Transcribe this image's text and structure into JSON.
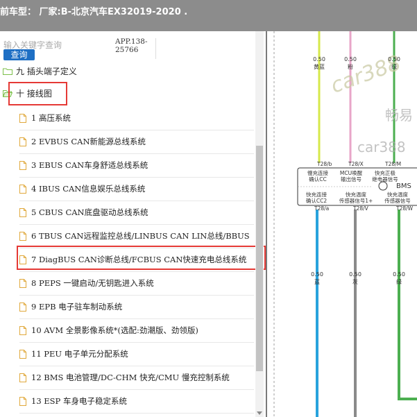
{
  "header": {
    "title": "前车型：  厂家:B-北京汽车EX32019-2020   ."
  },
  "search": {
    "placeholder": "输入关键字查询",
    "button": "查询"
  },
  "app_code": "APP.138-\n25766",
  "tree": {
    "partial_folder": "九 插头端子定义",
    "folder": "十 接线图",
    "items": [
      "1 高压系统",
      "2 EVBUS CAN新能源总线系统",
      "3 EBUS CAN车身舒适总线系统",
      "4 IBUS CAN信息娱乐总线系统",
      "5 CBUS CAN底盘驱动总线系统",
      "6 TBUS CAN远程监控总线/LINBUS CAN LIN总线/BBUS",
      "7 DiagBUS CAN诊断总线/FCBUS CAN快速充电总线系统",
      "8 PEPS 一键启动/无钥匙进入系统",
      "9 EPB 电子驻车制动系统",
      "10 AVM 全景影像系统*(选配:劲潮版、劲领版)",
      "11 PEU 电子单元分配系统",
      "12 BMS 电池管理/DC-CHM 快充/CMU 慢充控制系统",
      "13 ESP 车身电子稳定系统"
    ]
  },
  "diagram": {
    "top_wires": [
      {
        "gauge": "0.50",
        "color": "黄蓝"
      },
      {
        "gauge": "0.50",
        "color": "粉"
      },
      {
        "gauge": "0.50",
        "color": "绿"
      }
    ],
    "top_pins": [
      "T28/b",
      "T28/X",
      "T28/M"
    ],
    "connector_top_labels": [
      "慢充连接\n确认CC",
      "MCU唤醒\n输出信号",
      "快充正极\n继电器信号"
    ],
    "bms_label": "BMS",
    "connector_bottom_labels": [
      "快充连接\n确认CC2",
      "快充温度\n传感器信号1+",
      "快充温度\n传感器信号"
    ],
    "bottom_pins": [
      "T28/a",
      "T28/V",
      "T28/W"
    ],
    "bottom_wires": [
      {
        "gauge": "0.50",
        "color": "蓝"
      },
      {
        "gauge": "0.50",
        "color": "灰"
      },
      {
        "gauge": "0.50",
        "color": "绿"
      }
    ],
    "watermarks": [
      "car388",
      "畅易",
      "car388"
    ],
    "wire_colors": {
      "yellow": "#d6e84a",
      "pink": "#e8a6c8",
      "green": "#4caf50",
      "blue": "#29a3dd",
      "gray": "#8a8a8a"
    },
    "highlight_color": "#e53935"
  }
}
